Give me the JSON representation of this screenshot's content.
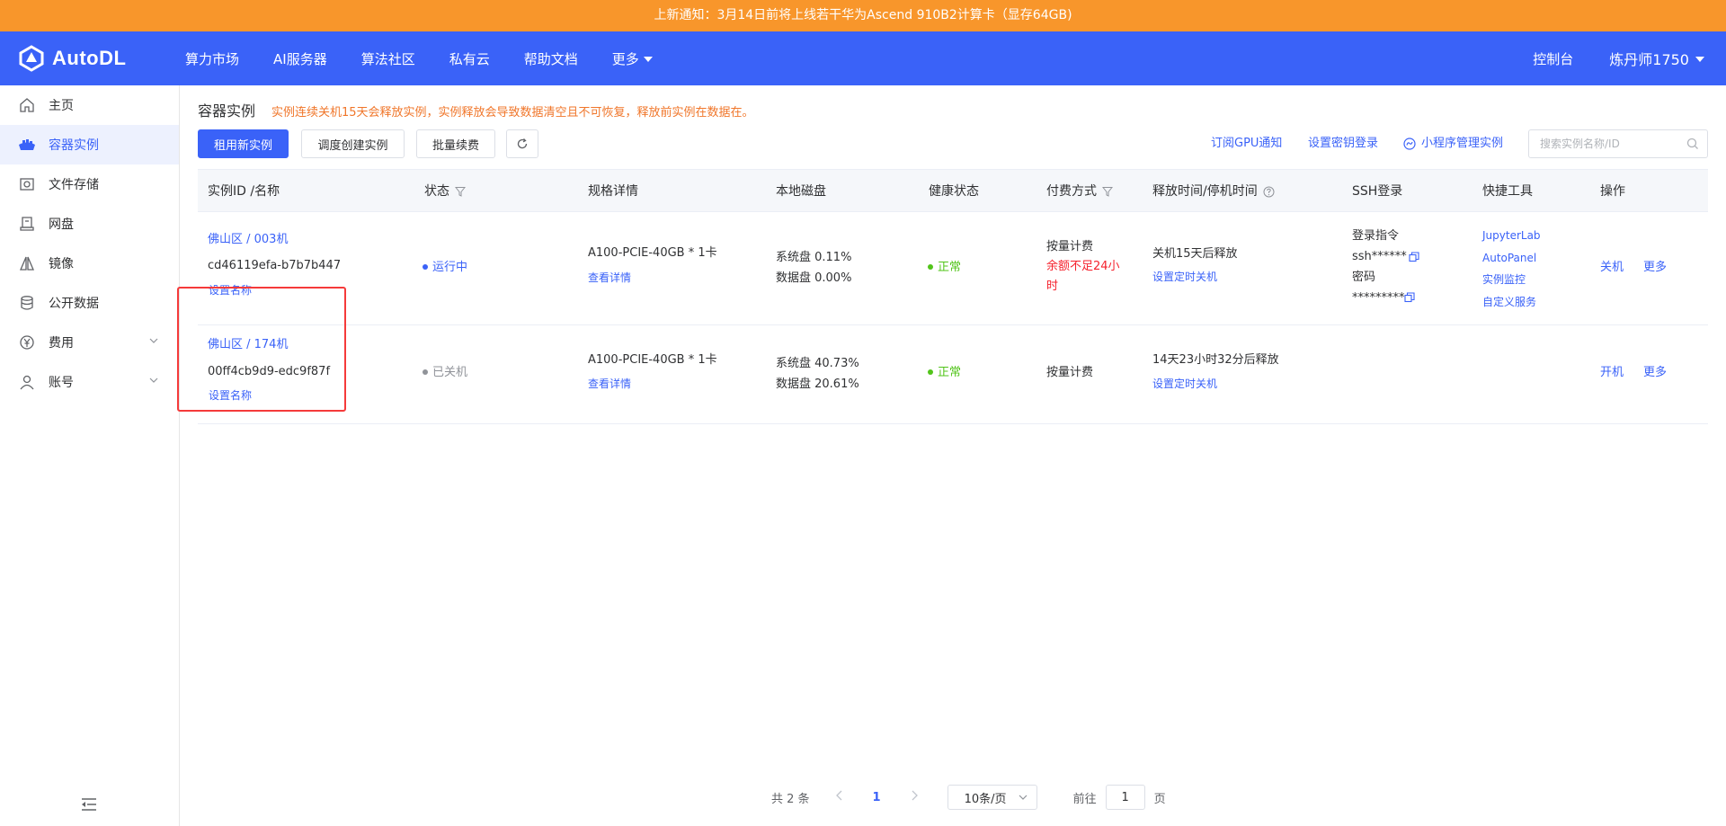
{
  "notice": "上新通知：3月14日前将上线若干华为Ascend 910B2计算卡（显存64GB)",
  "header": {
    "logo_text": "AutoDL",
    "nav": [
      "算力市场",
      "AI服务器",
      "算法社区",
      "私有云",
      "帮助文档",
      "更多"
    ],
    "console": "控制台",
    "user": "炼丹师1750"
  },
  "sidebar": {
    "items": [
      {
        "label": "主页",
        "icon": "home-icon"
      },
      {
        "label": "容器实例",
        "icon": "container-icon"
      },
      {
        "label": "文件存储",
        "icon": "storage-icon"
      },
      {
        "label": "网盘",
        "icon": "disk-icon"
      },
      {
        "label": "镜像",
        "icon": "image-icon"
      },
      {
        "label": "公开数据",
        "icon": "database-icon"
      },
      {
        "label": "费用",
        "icon": "yen-icon"
      },
      {
        "label": "账号",
        "icon": "user-icon"
      }
    ]
  },
  "main": {
    "title": "容器实例",
    "warning": "实例连续关机15天会释放实例，实例释放会导致数据清空且不可恢复，释放前实例在数据在。",
    "buttons": {
      "rent": "租用新实例",
      "schedule": "调度创建实例",
      "renew": "批量续费"
    },
    "links": {
      "gpu_notify": "订阅GPU通知",
      "ssh_key": "设置密钥登录",
      "miniprogram": "小程序管理实例"
    },
    "search_placeholder": "搜索实例名称/ID"
  },
  "table": {
    "headers": [
      "实例ID /名称",
      "状态",
      "规格详情",
      "本地磁盘",
      "健康状态",
      "付费方式",
      "释放时间/停机时间",
      "SSH登录",
      "快捷工具",
      "操作"
    ],
    "rows": [
      {
        "name": "佛山区 / 003机",
        "id": "cd46119efa-b7b7b447",
        "set_name": "设置名称",
        "status": "运行中",
        "spec": "A100-PCIE-40GB * 1卡",
        "spec_link": "查看详情",
        "sys_disk": "系统盘 0.11%",
        "data_disk": "数据盘 0.00%",
        "health": "正常",
        "pay": "按量计费",
        "pay_warn": "余额不足24小时",
        "release": "关机15天后释放",
        "release_link": "设置定时关机",
        "ssh_cmd_label": "登录指令",
        "ssh_cmd": "ssh******",
        "ssh_pwd_label": "密码",
        "ssh_pwd": "*********",
        "tools": [
          "JupyterLab",
          "AutoPanel",
          "实例监控",
          "自定义服务"
        ],
        "action": "关机",
        "more": "更多"
      },
      {
        "name": "佛山区 / 174机",
        "id": "00ff4cb9d9-edc9f87f",
        "set_name": "设置名称",
        "status": "已关机",
        "spec": "A100-PCIE-40GB * 1卡",
        "spec_link": "查看详情",
        "sys_disk": "系统盘 40.73%",
        "data_disk": "数据盘 20.61%",
        "health": "正常",
        "pay": "按量计费",
        "release": "14天23小时32分后释放",
        "release_link": "设置定时关机",
        "action": "开机",
        "more": "更多"
      }
    ]
  },
  "pagination": {
    "total": "共 2 条",
    "current": "1",
    "page_size": "10条/页",
    "goto_prefix": "前往",
    "goto_value": "1",
    "goto_suffix": "页"
  },
  "colors": {
    "notice": "#f8962b",
    "header": "#3a62f8",
    "primary": "#3a62f8",
    "warning": "#f0762a",
    "danger": "#f5222d",
    "success": "#52c41a",
    "highlight": "#f53a3a"
  }
}
